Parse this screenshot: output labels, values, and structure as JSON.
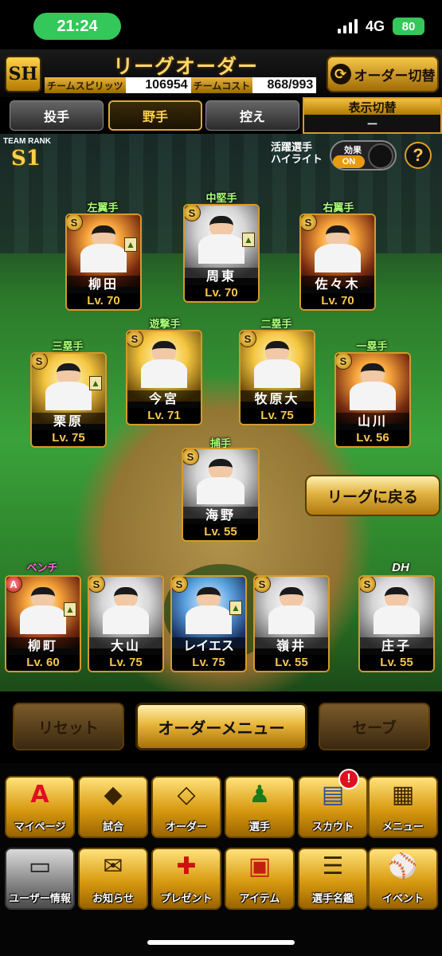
{
  "status_bar": {
    "time": "21:24",
    "network": "4G",
    "battery": "80"
  },
  "header": {
    "logo": "SH",
    "title": "リーグオーダー",
    "team_spirits_label": "チームスピリッツ",
    "team_spirits_value": "106954",
    "team_cost_label": "チームコスト",
    "team_cost_value": "868/993",
    "order_switch_label": "オーダー切替"
  },
  "tabs": [
    "投手",
    "野手",
    "控え"
  ],
  "active_tab": "野手",
  "display_switch": {
    "label": "表示切替",
    "value": "ー"
  },
  "team_rank": {
    "label": "TEAM RANK",
    "value": "S1"
  },
  "highlight": {
    "label_line1": "活躍選手",
    "label_line2": "ハイライト",
    "effect_label": "効果",
    "effect_state": "ON",
    "help": "?"
  },
  "positions": {
    "lf": "左翼手",
    "cf": "中堅手",
    "rf": "右翼手",
    "ss": "遊撃手",
    "b2": "二塁手",
    "b3": "三塁手",
    "b1": "一塁手",
    "c": "捕手",
    "bench": "ベンチ",
    "dh": "DH"
  },
  "players": {
    "lf": {
      "name": "柳田",
      "level": "Lv. 70",
      "badge": "S"
    },
    "cf": {
      "name": "周東",
      "level": "Lv. 70",
      "badge": "S"
    },
    "rf": {
      "name": "佐々木",
      "level": "Lv. 70",
      "badge": "S"
    },
    "b3": {
      "name": "栗原",
      "level": "Lv. 75",
      "badge": "S"
    },
    "ss": {
      "name": "今宮",
      "level": "Lv. 71",
      "badge": "S"
    },
    "b2": {
      "name": "牧原大",
      "level": "Lv. 75",
      "badge": "S"
    },
    "b1": {
      "name": "山川",
      "level": "Lv. 56",
      "badge": "S"
    },
    "c": {
      "name": "海野",
      "level": "Lv. 55",
      "badge": "S"
    },
    "bench1": {
      "name": "柳町",
      "level": "Lv. 60",
      "badge": "A"
    },
    "bench2": {
      "name": "大山",
      "level": "Lv. 75",
      "badge": "S"
    },
    "bench3": {
      "name": "レイエス",
      "level": "Lv. 75",
      "badge": "S"
    },
    "bench4": {
      "name": "嶺井",
      "level": "Lv. 55",
      "badge": "S"
    },
    "dh": {
      "name": "庄子",
      "level": "Lv. 55",
      "badge": "S"
    }
  },
  "league_back_label": "リーグに戻る",
  "actions": {
    "reset": "リセット",
    "order_menu": "オーダーメニュー",
    "save": "セーブ"
  },
  "nav_row1": [
    {
      "label": "マイページ",
      "icon": "home-A-icon",
      "glyph": "A"
    },
    {
      "label": "試合",
      "icon": "stadium-icon",
      "glyph": "◆"
    },
    {
      "label": "オーダー",
      "icon": "field-icon",
      "glyph": "◇"
    },
    {
      "label": "選手",
      "icon": "player-icon",
      "glyph": "♟"
    },
    {
      "label": "スカウト",
      "icon": "scout-card-icon",
      "glyph": "▤"
    },
    {
      "label": "メニュー",
      "icon": "menu-box-icon",
      "glyph": "▦"
    }
  ],
  "nav_row2": [
    {
      "label": "ユーザー情報",
      "icon": "user-info-icon",
      "glyph": "▭"
    },
    {
      "label": "お知らせ",
      "icon": "notice-icon",
      "glyph": "✉"
    },
    {
      "label": "プレゼント",
      "icon": "gift-icon",
      "glyph": "✚"
    },
    {
      "label": "アイテム",
      "icon": "item-icon",
      "glyph": "▣"
    },
    {
      "label": "選手名鑑",
      "icon": "player-book-icon",
      "glyph": "☰"
    },
    {
      "label": "イベント",
      "icon": "event-bat-icon",
      "glyph": "⚾"
    }
  ],
  "scout_notice": "!"
}
